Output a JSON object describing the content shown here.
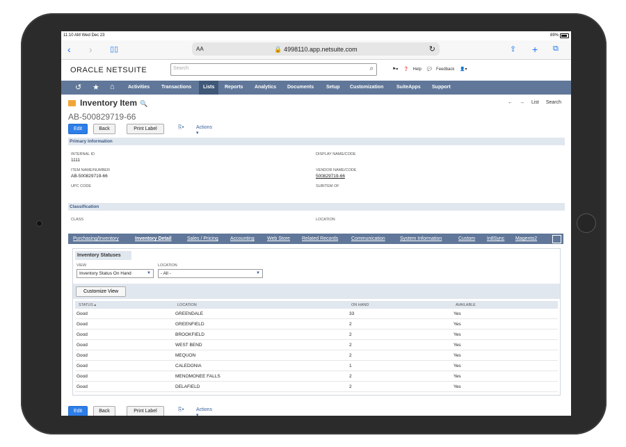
{
  "status_bar": {
    "time": "11:10 AM  Wed Dec 23",
    "battery": "89%"
  },
  "safari": {
    "text_size": "AA",
    "url": "4998110.app.netsuite.com"
  },
  "header": {
    "logo": "ORACLE NETSUITE",
    "search_placeholder": "Search",
    "help": "Help",
    "feedback": "Feedback"
  },
  "menu": [
    "Activities",
    "Transactions",
    "Lists",
    "Reports",
    "Analytics",
    "Documents",
    "Setup",
    "Customization",
    "SuiteApps",
    "Support"
  ],
  "menu_selected": "Lists",
  "page": {
    "title": "Inventory Item",
    "record_id": "AB-500829719-66",
    "nav_list": "List",
    "nav_search": "Search"
  },
  "buttons": {
    "edit": "Edit",
    "back": "Back",
    "print_label": "Print Label",
    "actions": "Actions"
  },
  "primary": {
    "heading": "Primary Information",
    "internal_id_label": "INTERNAL ID",
    "internal_id": "1111",
    "item_name_label": "ITEM NAME/NUMBER",
    "item_name": "AB-500829719-66",
    "upc_label": "UPC CODE",
    "display_name_label": "DISPLAY NAME/CODE",
    "vendor_name_label": "VENDOR NAME/CODE",
    "vendor_name": "500829719-66",
    "subitem_label": "SUBITEM OF"
  },
  "classification": {
    "heading": "Classification",
    "class_label": "CLASS",
    "location_label": "LOCATION"
  },
  "tabs": [
    "Purchasing/Inventory",
    "Inventory Detail",
    "Sales / Pricing",
    "Accounting",
    "Web Store",
    "Related Records",
    "Communication",
    "System Information",
    "Custom",
    "In8Sync",
    "Magento2"
  ],
  "active_tab": "Inventory Detail",
  "inventory": {
    "subtab": "Inventory Statuses",
    "view_label": "VIEW",
    "view_value": "Inventory Status On Hand",
    "location_label": "LOCATION",
    "location_value": "- All -",
    "customize_view": "Customize View",
    "columns": [
      "STATUS ▴",
      "LOCATION",
      "ON HAND",
      "AVAILABLE"
    ],
    "rows": [
      [
        "Good",
        "GREENDALE",
        "33",
        "Yes"
      ],
      [
        "Good",
        "GREENFIELD",
        "2",
        "Yes"
      ],
      [
        "Good",
        "BROOKFIELD",
        "2",
        "Yes"
      ],
      [
        "Good",
        "WEST BEND",
        "2",
        "Yes"
      ],
      [
        "Good",
        "MEQUON",
        "2",
        "Yes"
      ],
      [
        "Good",
        "CALEDONIA",
        "1",
        "Yes"
      ],
      [
        "Good",
        "MENOMONEE FALLS",
        "2",
        "Yes"
      ],
      [
        "Good",
        "DELAFIELD",
        "2",
        "Yes"
      ]
    ]
  },
  "colors": {
    "nav_bar": "#607799",
    "nav_selected": "#3f5878",
    "primary_button": "#2d7ee8",
    "section_bg": "#e1e7ef"
  }
}
